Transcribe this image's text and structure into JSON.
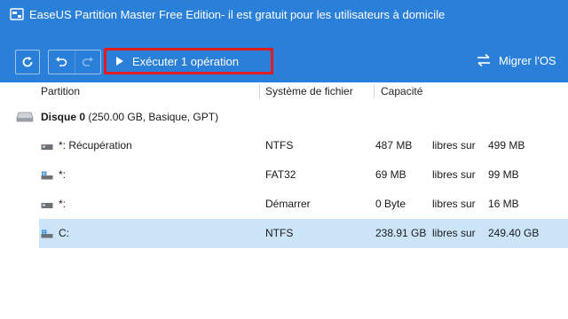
{
  "window": {
    "title": "EaseUS Partition Master Free Edition- il est gratuit pour les utilisateurs à domicile"
  },
  "toolbar": {
    "refresh_icon": "refresh-icon",
    "undo_icon": "undo-icon",
    "redo_icon": "redo-icon",
    "execute_label": "Exécuter 1 opération",
    "migrate_label": "Migrer l'OS",
    "accent_color": "#2a7fd8",
    "highlight_color": "#e01b22"
  },
  "table": {
    "headers": {
      "partition": "Partition",
      "filesystem": "Système de fichier",
      "capacity": "Capacité"
    },
    "disk": {
      "name": "Disque 0",
      "details": " (250.00 GB, Basique, GPT)"
    },
    "rows": [
      {
        "name": "*: Récupération",
        "fs": "NTFS",
        "free": "487 MB",
        "sep": "libres sur",
        "total": "499 MB",
        "icon": "drive-icon",
        "selected": false
      },
      {
        "name": "*:",
        "fs": "FAT32",
        "free": "69 MB",
        "sep": "libres sur",
        "total": "99 MB",
        "icon": "windows-drive-icon",
        "selected": false
      },
      {
        "name": "*:",
        "fs": "Démarrer",
        "free": "0 Byte",
        "sep": "libres sur",
        "total": "16 MB",
        "icon": "drive-icon",
        "selected": false
      },
      {
        "name": "C:",
        "fs": "NTFS",
        "free": "238.91 GB",
        "sep": "libres sur",
        "total": "249.40 GB",
        "icon": "windows-drive-icon",
        "selected": true
      }
    ],
    "selected_color": "#cce4f7"
  }
}
